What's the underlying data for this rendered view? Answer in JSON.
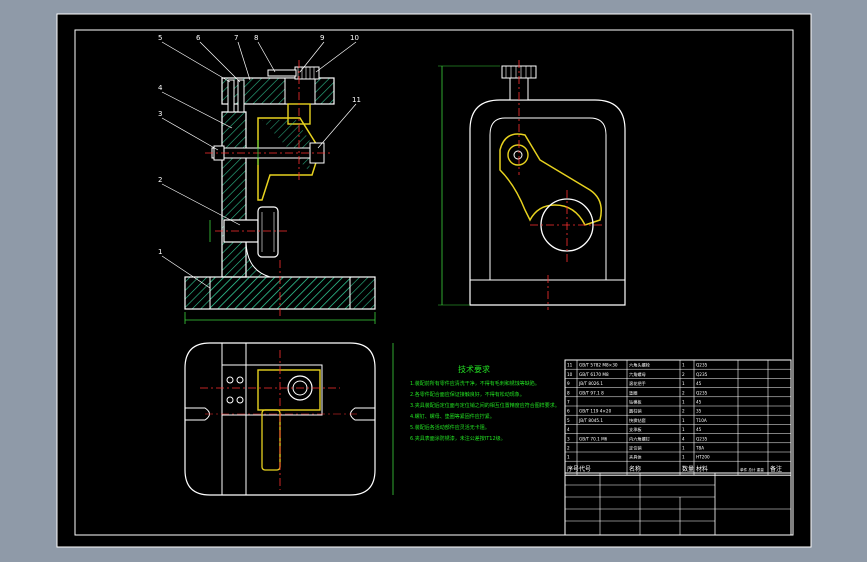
{
  "colors": {
    "desktop": "#8f9aa8",
    "paper": "#000000",
    "outline": "#ffffff",
    "hatch": "#2fbf8e",
    "part": "#e7d21f",
    "center": "#ff3030",
    "dim": "#3bd23b",
    "note": "#22e022"
  },
  "balloons": [
    "5",
    "6",
    "7",
    "8",
    "9",
    "10",
    "4",
    "3",
    "11",
    "2",
    "1"
  ],
  "notes": {
    "title": "技术要求",
    "lines": [
      "1.装配前所有零件应清洗干净，不得有毛刺和锈蚀等缺陷。",
      "2.各零件配合面应保证接触良好，不得有松动现象。",
      "3.夹具装配后定位面与定位销之间的相互位置精度应符合图样要求。",
      "4.螺钉、螺母、垫圈等紧固件应拧紧。",
      "5.装配后各活动部件应灵活无卡阻。",
      "6.夹具表面涂防锈漆，未注公差按IT12级。"
    ]
  },
  "titleblock": {
    "rows": [
      {
        "no": "11",
        "code": "GB/T 5782 M8×30",
        "name": "六角头螺栓",
        "qty": "1",
        "mat": "Q235",
        "note": ""
      },
      {
        "no": "10",
        "code": "GB/T 6170 M8",
        "name": "六角螺母",
        "qty": "2",
        "mat": "Q235",
        "note": ""
      },
      {
        "no": "9",
        "code": "JB/T 8026.1",
        "name": "滚花把手",
        "qty": "1",
        "mat": "45",
        "note": ""
      },
      {
        "no": "8",
        "code": "GB/T 97.1 8",
        "name": "垫圈",
        "qty": "2",
        "mat": "Q235",
        "note": ""
      },
      {
        "no": "7",
        "code": "",
        "name": "钻模板",
        "qty": "1",
        "mat": "45",
        "note": ""
      },
      {
        "no": "6",
        "code": "GB/T 119 4×20",
        "name": "圆柱销",
        "qty": "2",
        "mat": "35",
        "note": ""
      },
      {
        "no": "5",
        "code": "JB/T 8045.1",
        "name": "快换钻套",
        "qty": "1",
        "mat": "T10A",
        "note": ""
      },
      {
        "no": "4",
        "code": "",
        "name": "支承板",
        "qty": "1",
        "mat": "45",
        "note": ""
      },
      {
        "no": "3",
        "code": "GB/T 70.1 M6",
        "name": "内六角螺钉",
        "qty": "4",
        "mat": "Q235",
        "note": ""
      },
      {
        "no": "2",
        "code": "",
        "name": "定位销",
        "qty": "1",
        "mat": "T8A",
        "note": ""
      },
      {
        "no": "1",
        "code": "",
        "name": "夹具体",
        "qty": "1",
        "mat": "HT200",
        "note": ""
      }
    ],
    "header": {
      "no": "序号",
      "code": "代号",
      "name": "名称",
      "qty": "数量",
      "mat": "材料",
      "weight": "单件 总计 重量",
      "note": "备注"
    }
  }
}
